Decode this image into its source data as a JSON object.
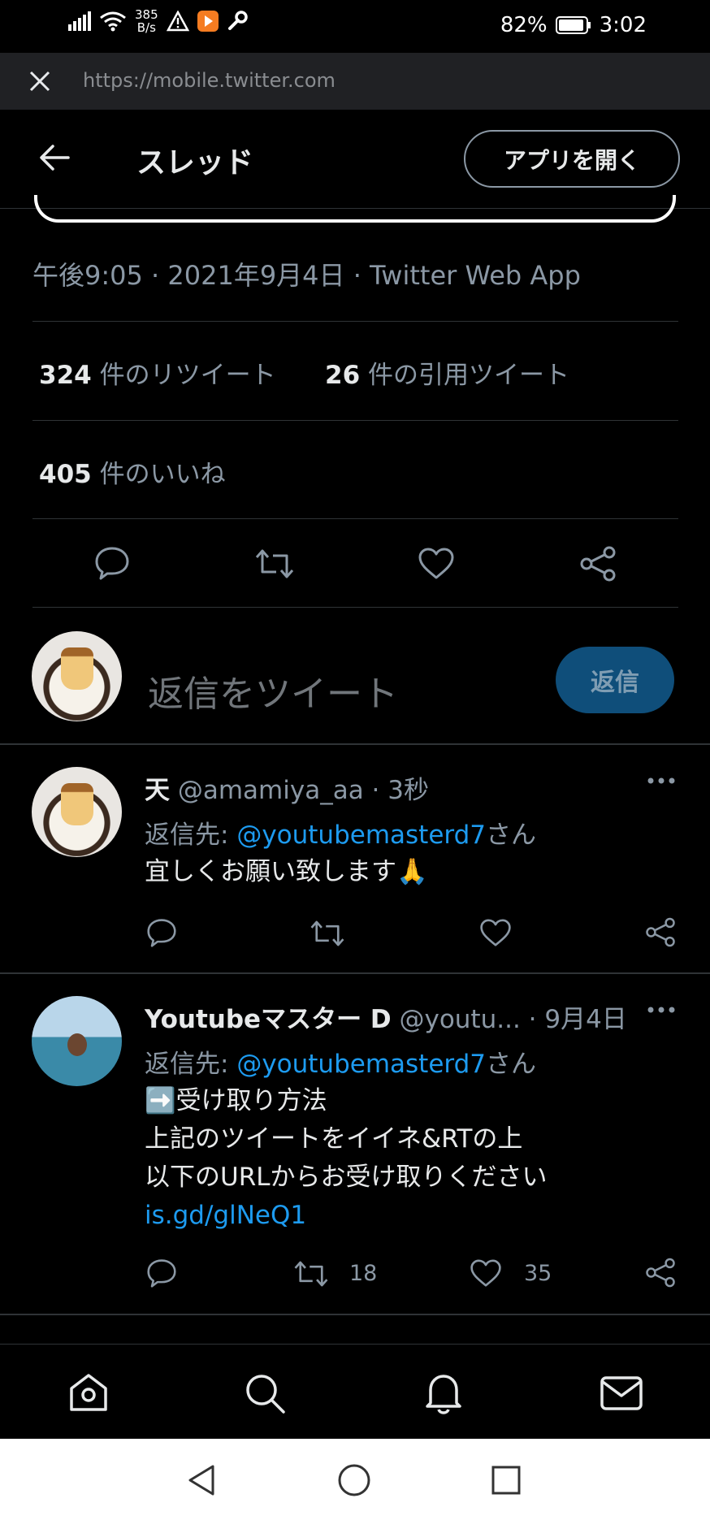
{
  "status_bar": {
    "net_speed": "385",
    "net_unit": "B/s",
    "battery": "82%",
    "time": "3:02"
  },
  "browser": {
    "url": "https://mobile.twitter.com"
  },
  "header": {
    "title": "スレッド",
    "open_app": "アプリを開く"
  },
  "tweet": {
    "timestamp": "午後9:05 · 2021年9月4日 · Twitter Web App",
    "retweets_count": "324",
    "retweets_label": " 件のリツイート",
    "quotes_count": "26",
    "quotes_label": " 件の引用ツイート",
    "likes_count": "405",
    "likes_label": " 件のいいね"
  },
  "composer": {
    "placeholder": "返信をツイート",
    "button": "返信"
  },
  "replies": [
    {
      "name": "天",
      "handle": "@amamiya_aa · 3秒",
      "reply_prefix": "返信先: ",
      "reply_mention": "@youtubemasterd7",
      "reply_suffix": "さん",
      "text": "宜しくお願い致します🙏"
    },
    {
      "name": "Youtubeマスター D",
      "handle": "@youtu... · 9月4日",
      "reply_prefix": "返信先: ",
      "reply_mention": "@youtubemasterd7",
      "reply_suffix": "さん",
      "line1": "➡️受け取り方法",
      "line2": "上記のツイートをイイネ&RTの上",
      "line3": "以下のURLからお受け取りください",
      "link": "is.gd/glNeQ1",
      "retweet_count": "18",
      "like_count": "35"
    }
  ]
}
